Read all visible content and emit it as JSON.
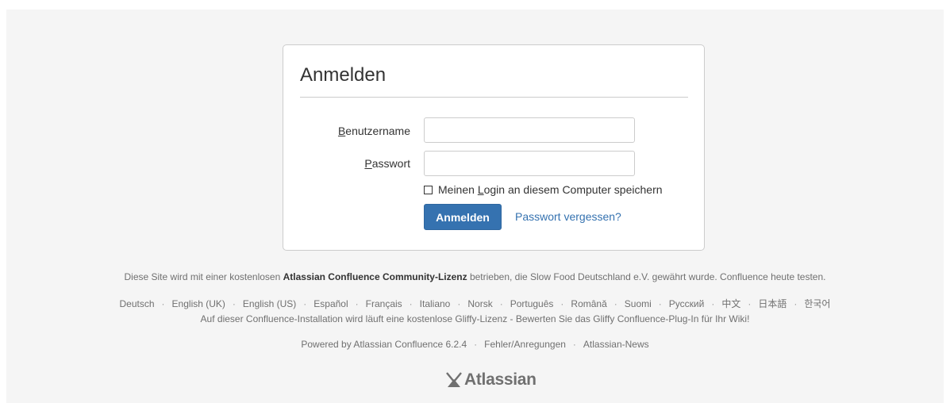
{
  "login": {
    "title": "Anmelden",
    "username_label_key": "B",
    "username_label_rest": "enutzername",
    "username_value": "",
    "password_label_key": "P",
    "password_label_rest": "asswort",
    "password_value": "",
    "remember_prefix": "Meinen ",
    "remember_key": "L",
    "remember_rest": "ogin an diesem Computer speichern",
    "remember_checked": false,
    "submit_label": "Anmelden",
    "forgot_label": "Passwort vergessen?"
  },
  "license": {
    "prefix": "Diese Site wird mit einer kostenlosen ",
    "bold": "Atlassian Confluence Community-Lizenz",
    "suffix": " betrieben, die Slow Food Deutschland e.V. gewährt wurde. Confluence heute testen."
  },
  "languages": [
    "Deutsch",
    "English (UK)",
    "English (US)",
    "Español",
    "Français",
    "Italiano",
    "Norsk",
    "Português",
    "Română",
    "Suomi",
    "Русский",
    "中文",
    "日本語",
    "한국어"
  ],
  "gliffy_notice": "Auf dieser Confluence-Installation wird läuft eine kostenlose Gliffy-Lizenz - Bewerten Sie das Gliffy Confluence-Plug-In für Ihr Wiki!",
  "footer": {
    "powered_by": "Powered by Atlassian Confluence 6.2.4",
    "feedback": "Fehler/Anregungen",
    "news": "Atlassian-News",
    "separator": "·"
  },
  "logo": {
    "text": "Atlassian",
    "icon": "atlassian-icon"
  },
  "colors": {
    "primary": "#3572b0",
    "link": "#3572b0",
    "background": "#f5f5f5"
  }
}
